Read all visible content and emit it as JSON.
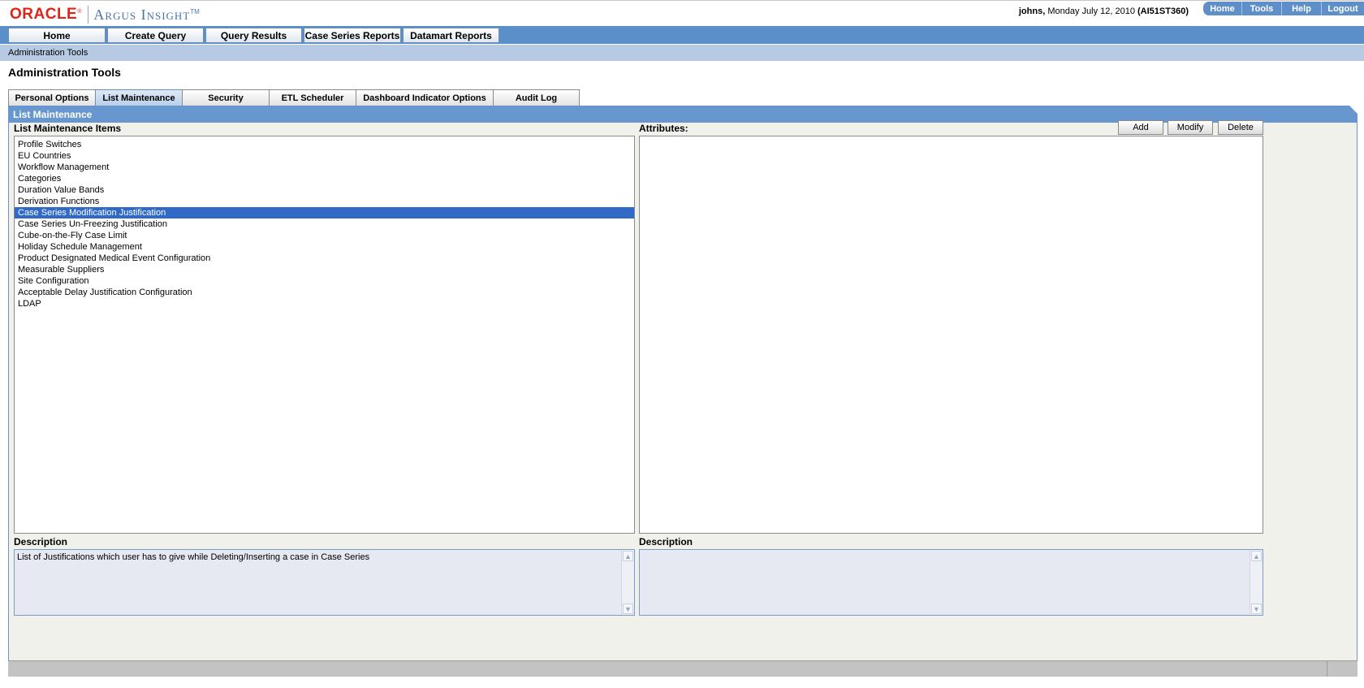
{
  "brand": {
    "oracle": "ORACLE",
    "registered": "®",
    "product": "Argus Insight",
    "trademark": "TM"
  },
  "user": {
    "name": "johns,",
    "date": "Monday July 12, 2010",
    "server": "(AI51ST360)"
  },
  "global_links": [
    "Home",
    "Tools",
    "Help",
    "Logout"
  ],
  "nav": [
    "Home",
    "Create Query",
    "Query Results",
    "Case Series Reports",
    "Datamart Reports"
  ],
  "breadcrumb": "Administration Tools",
  "page_title": "Administration Tools",
  "tabs": {
    "items": [
      "Personal Options",
      "List Maintenance",
      "Security",
      "ETL Scheduler",
      "Dashboard Indicator Options",
      "Audit Log"
    ],
    "active": "List Maintenance"
  },
  "panel": {
    "title": "List Maintenance",
    "items_label": "List Maintenance Items",
    "attributes_label": "Attributes:",
    "buttons": {
      "add": "Add",
      "modify": "Modify",
      "delete": "Delete"
    },
    "items": [
      "Profile Switches",
      "EU Countries",
      "Workflow Management",
      "Categories",
      "Duration Value Bands",
      "Derivation Functions",
      "Case Series Modification Justification",
      "Case Series Un-Freezing Justification",
      "Cube-on-the-Fly Case Limit",
      "Holiday Schedule Management",
      "Product Designated Medical Event Configuration",
      "Measurable Suppliers",
      "Site Configuration",
      "Acceptable Delay Justification Configuration",
      "LDAP"
    ],
    "selected_item": "Case Series Modification Justification",
    "description_label_left": "Description",
    "description_label_right": "Description",
    "description_left": "List of Justifications which user has to give while Deleting/Inserting a case in Case Series",
    "description_right": ""
  },
  "colors": {
    "nav_bar": "#5a8fca",
    "breadcrumb_bar": "#b7cae4",
    "panel_header": "#6897cf",
    "selection": "#3169c6",
    "oracle_red": "#e2231a"
  }
}
